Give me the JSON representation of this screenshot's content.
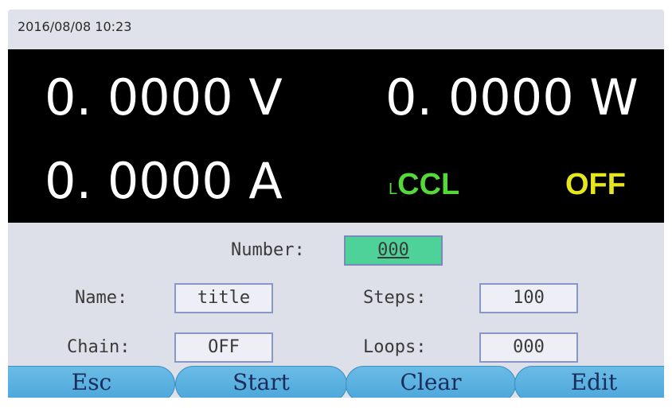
{
  "status_bar": {
    "datetime": "2016/08/08 10:23"
  },
  "readout": {
    "voltage": "0. 0000 V",
    "power": "0. 0000 W",
    "current": "0. 0000 A",
    "mode_prefix": "L",
    "mode": "CCL",
    "output_state": "OFF",
    "colors": {
      "background": "#000000",
      "value_text": "#ffffff",
      "mode_text": "#55d83a",
      "output_state_text": "#e6e61e"
    }
  },
  "form": {
    "number": {
      "label": "Number:",
      "value": "000"
    },
    "name": {
      "label": "Name:",
      "value": "title"
    },
    "steps": {
      "label": "Steps:",
      "value": "100"
    },
    "chain": {
      "label": "Chain:",
      "value": "OFF"
    },
    "loops": {
      "label": "Loops:",
      "value": "000"
    },
    "colors": {
      "selected_field": "#4fd29a",
      "field_background": "#eeeef7",
      "field_border": "#8a96c8"
    }
  },
  "softkeys": {
    "esc": "Esc",
    "start": "Start",
    "clear": "Clear",
    "edit": "Edit",
    "color": "#5ab2e2"
  }
}
